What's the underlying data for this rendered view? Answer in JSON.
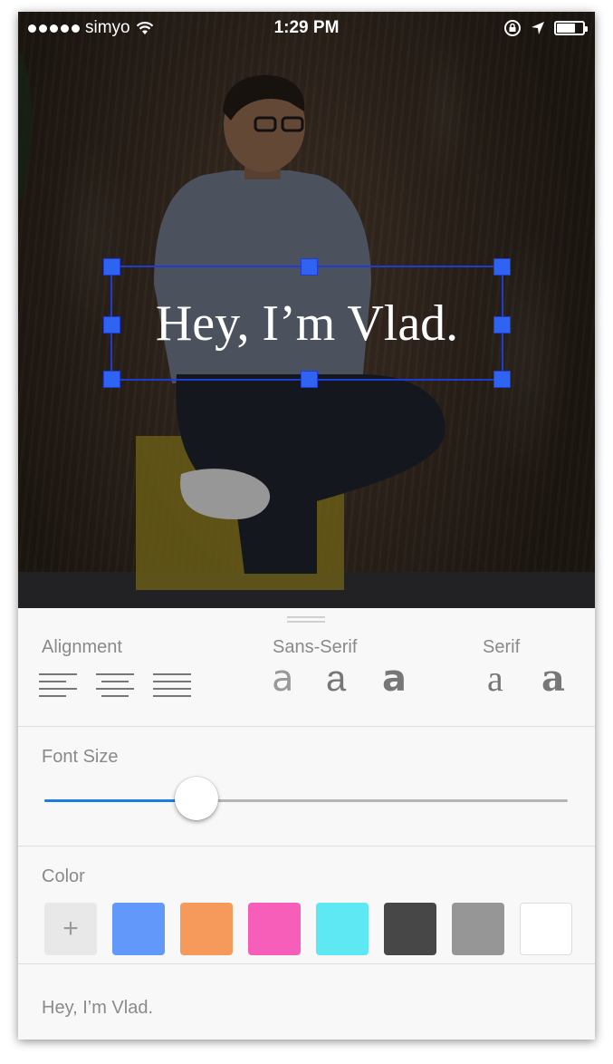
{
  "status_bar": {
    "carrier": "simyo",
    "time": "1:29 PM",
    "signal_bars": 5,
    "battery_level": 0.7
  },
  "canvas": {
    "headline": "Hey, I’m Vlad."
  },
  "editor": {
    "alignment": {
      "label": "Alignment",
      "options": [
        "left",
        "center",
        "justify"
      ]
    },
    "sans_serif": {
      "label": "Sans-Serif",
      "options": [
        {
          "glyph": "a",
          "weight": "light"
        },
        {
          "glyph": "a",
          "weight": "regular"
        },
        {
          "glyph": "a",
          "weight": "bold"
        }
      ]
    },
    "serif": {
      "label": "Serif",
      "options": [
        {
          "glyph": "a",
          "weight": "regular"
        },
        {
          "glyph": "a",
          "weight": "bold"
        }
      ]
    },
    "font_size": {
      "label": "Font Size",
      "value_fraction": 0.29
    },
    "color": {
      "label": "Color",
      "add_symbol": "+",
      "swatches": [
        "#6398fb",
        "#f59a5b",
        "#f65eb9",
        "#5de8f4",
        "#474747",
        "#969696",
        "#ffffff"
      ]
    },
    "text_field": {
      "value": "Hey, I’m Vlad."
    }
  }
}
